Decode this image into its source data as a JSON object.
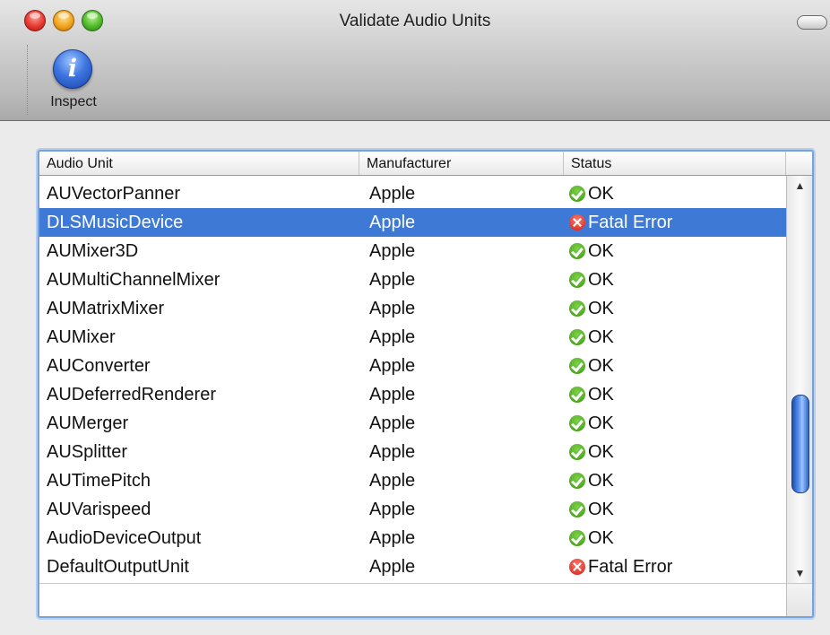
{
  "window": {
    "title": "Validate Audio Units"
  },
  "toolbar": {
    "inspect_label": "Inspect",
    "inspect_icon": "info-icon",
    "inspect_icon_glyph": "i"
  },
  "table": {
    "columns": [
      "Audio Unit",
      "Manufacturer",
      "Status"
    ],
    "rows": [
      {
        "name": "AUVectorPanner",
        "manufacturer": "Apple",
        "status": "OK",
        "status_kind": "ok"
      },
      {
        "name": "DLSMusicDevice",
        "manufacturer": "Apple",
        "status": "Fatal Error",
        "status_kind": "error",
        "selected": true
      },
      {
        "name": "AUMixer3D",
        "manufacturer": "Apple",
        "status": "OK",
        "status_kind": "ok"
      },
      {
        "name": "AUMultiChannelMixer",
        "manufacturer": "Apple",
        "status": "OK",
        "status_kind": "ok"
      },
      {
        "name": "AUMatrixMixer",
        "manufacturer": "Apple",
        "status": "OK",
        "status_kind": "ok"
      },
      {
        "name": "AUMixer",
        "manufacturer": "Apple",
        "status": "OK",
        "status_kind": "ok"
      },
      {
        "name": "AUConverter",
        "manufacturer": "Apple",
        "status": "OK",
        "status_kind": "ok"
      },
      {
        "name": "AUDeferredRenderer",
        "manufacturer": "Apple",
        "status": "OK",
        "status_kind": "ok"
      },
      {
        "name": "AUMerger",
        "manufacturer": "Apple",
        "status": "OK",
        "status_kind": "ok"
      },
      {
        "name": "AUSplitter",
        "manufacturer": "Apple",
        "status": "OK",
        "status_kind": "ok"
      },
      {
        "name": "AUTimePitch",
        "manufacturer": "Apple",
        "status": "OK",
        "status_kind": "ok"
      },
      {
        "name": "AUVarispeed",
        "manufacturer": "Apple",
        "status": "OK",
        "status_kind": "ok"
      },
      {
        "name": "AudioDeviceOutput",
        "manufacturer": "Apple",
        "status": "OK",
        "status_kind": "ok"
      },
      {
        "name": "DefaultOutputUnit",
        "manufacturer": "Apple",
        "status": "Fatal Error",
        "status_kind": "error"
      }
    ]
  },
  "scrollbar": {
    "up_arrow": "▲",
    "down_arrow": "▼",
    "position_fraction": 0.6
  },
  "colors": {
    "selection": "#3e7ad5",
    "ok": "#3a9a12",
    "error": "#d21f12",
    "scroll_thumb": "#3f78d8"
  }
}
